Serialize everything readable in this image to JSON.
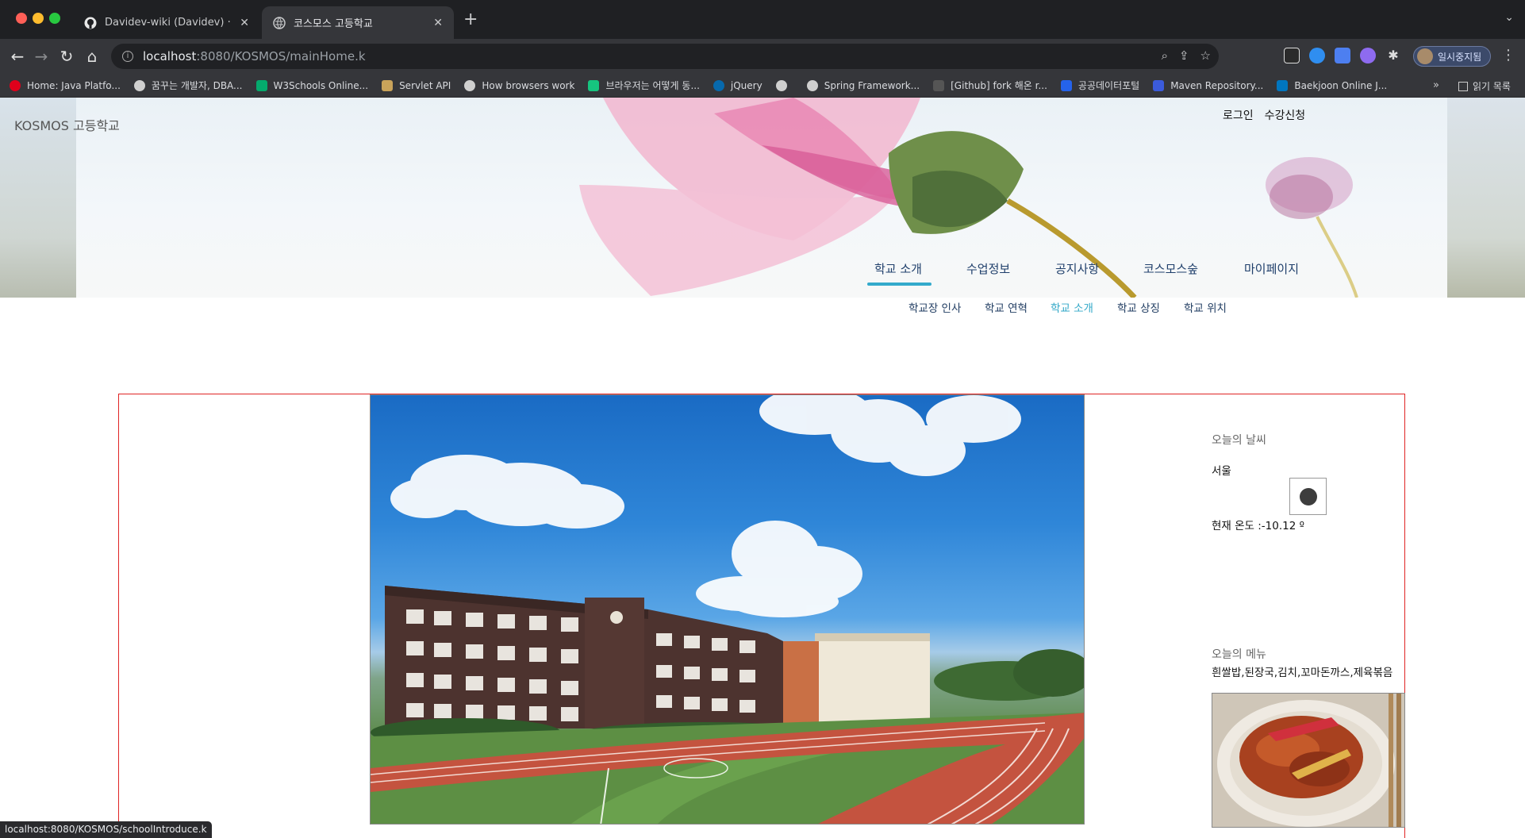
{
  "browser": {
    "tabs": [
      {
        "title": "Davidev-wiki (Davidev) · GitHub",
        "icon": "github-icon",
        "active": false
      },
      {
        "title": "코스모스 고등학교",
        "icon": "globe-icon",
        "active": true
      }
    ],
    "url_host": "localhost",
    "url_rest": ":8080/KOSMOS/mainHome.k",
    "profile_label": "일시중지됨",
    "bookmarks": [
      {
        "label": "Home: Java Platfo...",
        "icon": "oracle-icon",
        "color": "#e0001b"
      },
      {
        "label": "꿈꾸는 개발자, DBA...",
        "icon": "globe-icon",
        "color": "#cfcfcf"
      },
      {
        "label": "W3Schools Online...",
        "icon": "w3schools-icon",
        "color": "#04aa6d"
      },
      {
        "label": "Servlet API",
        "icon": "servlet-icon",
        "color": "#c9a35a"
      },
      {
        "label": "How browsers work",
        "icon": "globe-icon",
        "color": "#cfcfcf"
      },
      {
        "label": "브라우저는 어떻게 동...",
        "icon": "d2-icon",
        "color": "#16c47f"
      },
      {
        "label": "jQuery",
        "icon": "jquery-icon",
        "color": "#0769ad"
      },
      {
        "label": "",
        "icon": "globe-icon",
        "color": "#cfcfcf"
      },
      {
        "label": "Spring Framework...",
        "icon": "globe-icon",
        "color": "#cfcfcf"
      },
      {
        "label": "[Github] fork 해온 r...",
        "icon": "tistory-icon",
        "color": "#333333"
      },
      {
        "label": "공공데이터포털",
        "icon": "data-portal-icon",
        "color": "#2563eb"
      },
      {
        "label": "Maven Repository...",
        "icon": "maven-icon",
        "color": "#3b5bdb"
      },
      {
        "label": "Baekjoon Online J...",
        "icon": "baekjoon-icon",
        "color": "#0076c0"
      }
    ],
    "reading_list_label": "읽기 목록",
    "status_url": "localhost:8080/KOSMOS/schoolIntroduce.k"
  },
  "site": {
    "logo": "KOSMOS 고등학교",
    "top_links": [
      "로그인",
      "수강신청"
    ],
    "gnb": [
      "학교 소개",
      "수업정보",
      "공지사항",
      "코스모스숲",
      "마이페이지"
    ],
    "gnb_active": "학교 소개",
    "lnb": [
      "학교장 인사",
      "학교 연혁",
      "학교 소개",
      "학교 상징",
      "학교 위치"
    ],
    "lnb_active": "학교 소개"
  },
  "weather": {
    "title": "오늘의 날씨",
    "city": "서울",
    "temp_text": "현재 온도 :-10.12 º",
    "icon": "weather-icon"
  },
  "menu": {
    "title": "오늘의 메뉴",
    "items": "흰쌀밥,된장국,김치,꼬마돈까스,제육볶음"
  },
  "colors": {
    "accent": "#33aacc",
    "nav_text": "#1f3f6b",
    "content_border": "#e02424"
  }
}
